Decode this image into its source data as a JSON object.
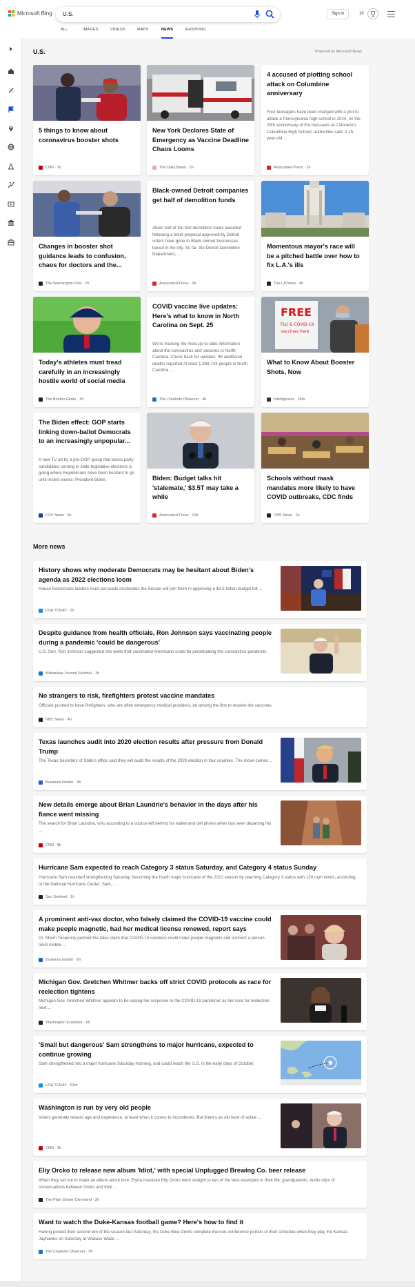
{
  "header": {
    "logo_text": "Microsoft Bing",
    "logo_colors": [
      "#f25022",
      "#7fba00",
      "#00a4ef",
      "#ffb900"
    ],
    "search_value": "U.S.",
    "signin_label": "Sign in",
    "rewards_points": "10",
    "accent_color": "#174ae4"
  },
  "tabs": [
    {
      "label": "ALL"
    },
    {
      "label": "IMAGES"
    },
    {
      "label": "VIDEOS"
    },
    {
      "label": "MAPS"
    },
    {
      "label": "NEWS",
      "active": true
    },
    {
      "label": "SHOPPING"
    }
  ],
  "sidebar_icons": [
    "expand-icon",
    "home-icon",
    "discover-icon",
    "flag-icon",
    "location-icon",
    "globe-icon",
    "science-icon",
    "sports-icon",
    "entertainment-icon",
    "politics-icon",
    "business-icon"
  ],
  "main": {
    "title": "U.S.",
    "powered_by": "Powered by Microsoft News"
  },
  "cards": [
    {
      "title": "5 things to know about coronavirus booster shots",
      "snippet": "",
      "source": "CNN",
      "age": "1h",
      "source_color": "#cc0000"
    },
    {
      "title": "New York Declares State of Emergency as Vaccine Deadline Chaos Looms",
      "snippet": "",
      "source": "The Daily Beast",
      "age": "2h",
      "source_color": "#f7a4a4"
    },
    {
      "title": "4 accused of plotting school attack on Columbine anniversary",
      "snippet": "Four teenagers have been charged with a plot to attack a Pennsylvania high school in 2024, on the 25th anniversary of the massacre at Colorado's Columbine High School, authorities said. A 15-year-old ...",
      "source": "Associated Press",
      "age": "2h",
      "source_color": "#d52b1e"
    },
    {
      "title": "Changes in booster shot guidance leads to confusion, chaos for doctors and the...",
      "snippet": "",
      "source": "The Washington Post",
      "age": "2h",
      "source_color": "#222222"
    },
    {
      "title": "Black-owned Detroit companies get half of demolition funds",
      "snippet": "About half of the first demolition funds awarded following a bond proposal approved by Detroit voters have gone to Black-owned businesses based in the city. So far, the Detroit Demolition Department, ...",
      "source": "Associated Press",
      "age": "3h",
      "source_color": "#d52b1e"
    },
    {
      "title": "Momentous mayor's race will be a pitched battle over how to fix L.A.'s ills",
      "snippet": "",
      "source": "The LATimes",
      "age": "4h",
      "source_color": "#222222"
    },
    {
      "title": "Today's athletes must tread carefully in an increasingly hostile world of social media",
      "snippet": "",
      "source": "The Boston Globe",
      "age": "3h",
      "source_color": "#222222"
    },
    {
      "title": "COVID vaccine live updates: Here's what to know in North Carolina on Sept. 25",
      "snippet": "We're tracking the most up-to-date information about the coronavirus and vaccines in North Carolina. Check back for updates. 96 additional deaths reported At least 1,368,743 people in North Carolina ...",
      "source": "The Charlotte Observer",
      "age": "4h",
      "source_color": "#1a73c9"
    },
    {
      "title": "What to Know About Booster Shots, Now",
      "snippet": "",
      "source": "Intelligencer",
      "age": "33m",
      "source_color": "#333333"
    },
    {
      "title": "The Biden effect: GOP starts linking down-ballot Democrats to an increasingly unpopular...",
      "snippet": "A new TV ad by a pro-GOP group that backs party candidates running in state legislative elections is going where Republicans have been hesitant to go until recent weeks: President Biden.",
      "source": "FOX News",
      "age": "6h",
      "source_color": "#1f3a93"
    },
    {
      "title": "Biden: Budget talks hit 'stalemate,' $3.5T may take a while",
      "snippet": "",
      "source": "Associated Press",
      "age": "10h",
      "source_color": "#d52b1e"
    },
    {
      "title": "Schools without mask mandates more likely to have COVID outbreaks, CDC finds",
      "snippet": "",
      "source": "CBS News",
      "age": "1h",
      "source_color": "#222222"
    }
  ],
  "more_news": {
    "title": "More news",
    "items": [
      {
        "title": "History shows why moderate Democrats may be hesitant about Biden's agenda as 2022 elections loom",
        "snippet": "House Democratic leaders must persuade moderates the Senate will join them in approving a $3.5 trillion budget bill ...",
        "source": "USA TODAY",
        "age": "2h",
        "source_color": "#1a8fe0"
      },
      {
        "title": "Despite guidance from health officials, Ron Johnson says vaccinating people during a pandemic 'could be dangerous'",
        "snippet": "U.S. Sen. Ron Johnson suggested this week that vaccinated Americans could be perpetuating the coronavirus pandemic.",
        "source": "Milwaukee Journal Sentinel",
        "age": "1h",
        "source_color": "#1a73c9"
      },
      {
        "title": "No strangers to risk, firefighters protest vaccine mandates",
        "snippet": "Officials pushed to have firefighters, who are often emergency medical providers, be among the first to receive the vaccines.",
        "source": "NBC News",
        "age": "4h",
        "source_color": "#222222"
      },
      {
        "title": "Texas launches audit into 2020 election results after pressure from Donald Trump",
        "snippet": "The Texas Secretary of State's office said they will audit the results of the 2020 election in four counties. The move comes ...",
        "source": "Business Insider",
        "age": "4h",
        "source_color": "#1f5fd6"
      },
      {
        "title": "New details emerge about Brian Laundrie's behavior in the days after his fiance went missing",
        "snippet": "The search for Brian Laundrie, who according to a source left behind his wallet and cell phone when last seen departing his ...",
        "source": "CNN",
        "age": "8h",
        "source_color": "#cc0000"
      },
      {
        "title": "Hurricane Sam expected to reach Category 3 status Saturday, and Category 4 status Sunday",
        "snippet": "Hurricane Sam resumed strengthening Saturday, becoming the fourth major hurricane of the 2021 season by reaching Category 3 status with 120 mph winds, according to the National Hurricane Center. Sam, ...",
        "source": "Sun Sentinel",
        "age": "1h",
        "source_color": "#222222"
      },
      {
        "title": "A prominent anti-vax doctor, who falsely claimed the COVID-19 vaccine could make people magnetic, had her medical license renewed, report says",
        "snippet": "Dr. Sherri Tenpenny pushed the false claim that COVID-19 vaccines could make people magnetic and connect a person to5G mobile ...",
        "source": "Business Insider",
        "age": "6h",
        "source_color": "#1f5fd6"
      },
      {
        "title": "Michigan Gov. Gretchen Whitmer backs off strict COVID protocols as race for reelection tightens",
        "snippet": "Michigan Gov. Gretchen Whitmer appears to be easing her response to the COVID-19 pandemic as her race for reelection next ...",
        "source": "Washington Examiner",
        "age": "6h",
        "source_color": "#222222"
      },
      {
        "title": "'Small but dangerous' Sam strengthens to major hurricane, expected to continue growing",
        "snippet": "Sam strengthened into a major hurricane Saturday morning, and could reach the U.S. in the early days of October.",
        "source": "USA TODAY",
        "age": "51m",
        "source_color": "#1a8fe0"
      },
      {
        "title": "Washington is run by very old people",
        "snippet": "Voters generally reward age and experience, at least when it comes to incumbents. But there's an old herd of active ...",
        "source": "CNN",
        "age": "2h",
        "source_color": "#cc0000"
      },
      {
        "title": "Eliy Orcko to release new album 'Idiot,' with special Unplugged Brewing Co. beer release",
        "snippet": "When they set out to make an album about love, Elyria musician Eliy Orcko went straight to two of the best examples in their life: grandparents. Audio clips of conversations between Orcko and their ...",
        "source": "The Plain Dealer Cleveland",
        "age": "2h",
        "source_color": "#222222"
      },
      {
        "title": "Want to watch the Duke-Kansas football game? Here's how to find it",
        "snippet": "Having posted their second win of the season last Saturday, the Duke Blue Devils complete the non-conference portion of their schedule when they play the Kansas Jayhawks on Saturday at Wallace Wade ...",
        "source": "The Charlotte Observer",
        "age": "5h",
        "source_color": "#1a73c9"
      }
    ]
  }
}
